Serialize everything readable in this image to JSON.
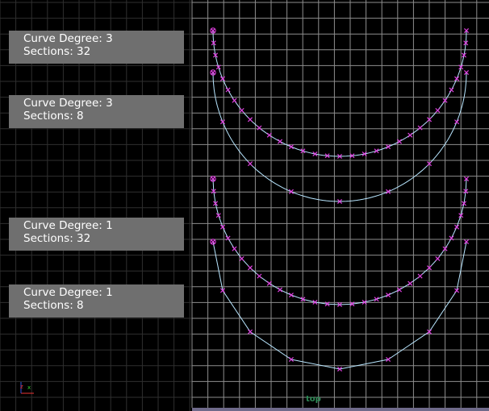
{
  "colors": {
    "background": "#000000",
    "grid_major": "#8e8e8e",
    "grid_minor": "#2f2f2f",
    "curve": "#b8e6ff",
    "cv": "#e040e0",
    "label_bg": "#6f6f6f",
    "label_text": "#ffffff",
    "view_name": "#2f8a57"
  },
  "labels": [
    {
      "degree_line": "Curve Degree: 3",
      "sections_line": "Sections: 32",
      "degree": 3,
      "sections": 32
    },
    {
      "degree_line": "Curve Degree: 3",
      "sections_line": "Sections: 8",
      "degree": 3,
      "sections": 8
    },
    {
      "degree_line": "Curve Degree: 1",
      "sections_line": "Sections: 32",
      "degree": 1,
      "sections": 32
    },
    {
      "degree_line": "Curve Degree: 1",
      "sections_line": "Sections: 8",
      "degree": 1,
      "sections": 8
    }
  ],
  "view": {
    "name": "top",
    "axis_icon": "axis-gizmo-icon"
  }
}
